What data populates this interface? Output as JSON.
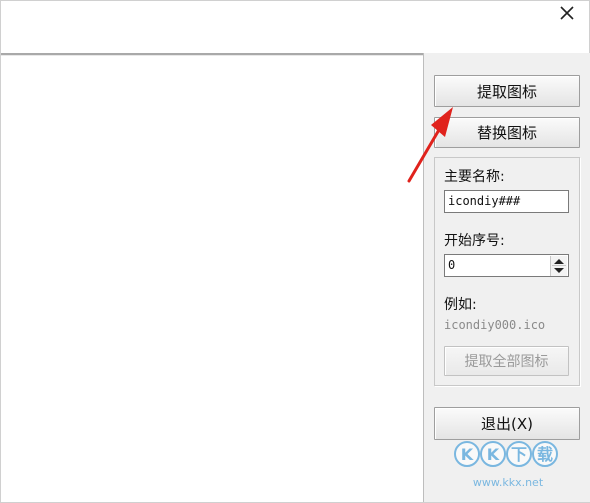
{
  "window": {
    "close_icon": "close-icon"
  },
  "buttons": {
    "extract_icon": "提取图标",
    "replace_icon": "替换图标",
    "extract_all": "提取全部图标",
    "exit": "退出(X)"
  },
  "group": {
    "main_name_label": "主要名称:",
    "main_name_value": "icondiy###",
    "start_index_label": "开始序号:",
    "start_index_value": "0",
    "example_label": "例如:",
    "example_value": "icondiy000.ico"
  },
  "annotation": {
    "arrow_color": "#e0221c"
  },
  "watermark": {
    "brand": "KK下载",
    "url": "www.kkx.net"
  }
}
